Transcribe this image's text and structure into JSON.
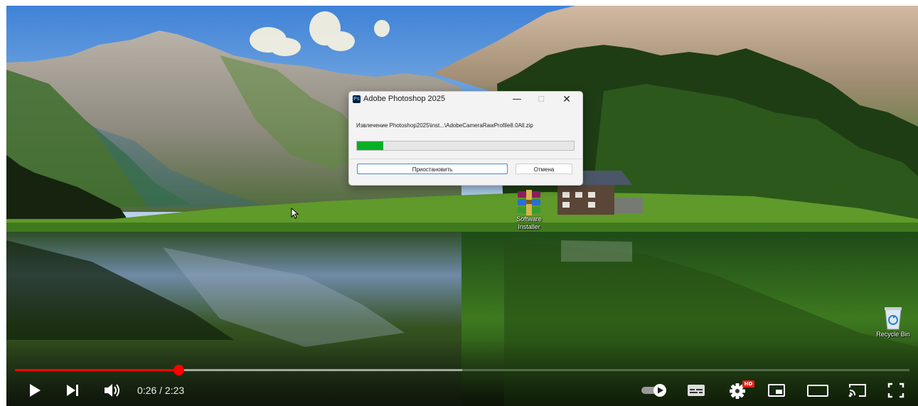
{
  "installer": {
    "title": "Adobe Photoshop 2025",
    "app_icon_text": "Ps",
    "icon": "photoshop-app-icon",
    "status_text": "Извлечение Photoshop2025\\inst...\\AdobeCameraRawProfile8.0All.zip",
    "progress_fraction": 0.12,
    "pause_label": "Приостановить",
    "cancel_label": "Отмена",
    "progress_color": "#06b025"
  },
  "desktop": {
    "icons": [
      {
        "label": "Software Installer",
        "icon": "winrar-archive-icon"
      },
      {
        "label": "Recycle Bin",
        "icon": "recycle-bin-icon"
      }
    ]
  },
  "player": {
    "time": "0:26 / 2:23",
    "played_fraction": 0.183,
    "buffered_fraction": 0.5,
    "accent_color": "#ff0000",
    "hd_badge": "HD",
    "buttons": [
      {
        "name": "play-button",
        "icon": "play-icon"
      },
      {
        "name": "next-button",
        "icon": "skip-next-icon"
      },
      {
        "name": "volume-button",
        "icon": "volume-icon"
      },
      {
        "name": "autoplay-toggle",
        "icon": "autoplay-toggle-icon"
      },
      {
        "name": "subtitles-button",
        "icon": "subtitles-icon"
      },
      {
        "name": "settings-button",
        "icon": "gear-icon"
      },
      {
        "name": "miniplayer-button",
        "icon": "miniplayer-icon"
      },
      {
        "name": "theater-mode-button",
        "icon": "theater-icon"
      },
      {
        "name": "cast-button",
        "icon": "cast-icon"
      },
      {
        "name": "fullscreen-button",
        "icon": "fullscreen-icon"
      }
    ]
  }
}
